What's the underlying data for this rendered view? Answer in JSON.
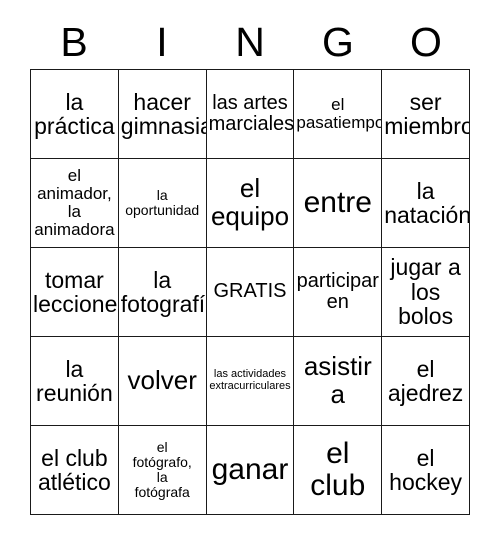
{
  "card": {
    "title": "BINGO",
    "header_letters": [
      "B",
      "I",
      "N",
      "G",
      "O"
    ],
    "columns": 5,
    "rows": 5,
    "border_color": "#1a1a1a",
    "background_color": "#ffffff",
    "text_color": "#000000"
  },
  "cells": [
    {
      "text": "la\npráctica",
      "size": "lg",
      "row": 1,
      "col": 1
    },
    {
      "text": "hacer\ngimnasia",
      "size": "lg",
      "row": 1,
      "col": 2
    },
    {
      "text": "las artes\nmarciales",
      "size": "md",
      "row": 1,
      "col": 3
    },
    {
      "text": "el\npasatiempo",
      "size": "sm",
      "row": 1,
      "col": 4
    },
    {
      "text": "ser\nmiembro",
      "size": "lg",
      "row": 1,
      "col": 5
    },
    {
      "text": "el\nanimador,\nla\nanimadora",
      "size": "sm",
      "row": 2,
      "col": 1
    },
    {
      "text": "la\noportunidad",
      "size": "xs",
      "row": 2,
      "col": 2
    },
    {
      "text": "el\nequipo",
      "size": "xl",
      "row": 2,
      "col": 3
    },
    {
      "text": "entre",
      "size": "xxl",
      "row": 2,
      "col": 4
    },
    {
      "text": "la\nnatación",
      "size": "lg",
      "row": 2,
      "col": 5
    },
    {
      "text": "tomar\nlecciones",
      "size": "lg",
      "row": 3,
      "col": 1
    },
    {
      "text": "la\nfotografía",
      "size": "lg",
      "row": 3,
      "col": 2
    },
    {
      "text": "GRATIS",
      "size": "md",
      "row": 3,
      "col": 3
    },
    {
      "text": "participar\nen",
      "size": "md",
      "row": 3,
      "col": 4
    },
    {
      "text": "jugar a\nlos\nbolos",
      "size": "lg",
      "row": 3,
      "col": 5
    },
    {
      "text": "la\nreunión",
      "size": "lg",
      "row": 4,
      "col": 1
    },
    {
      "text": "volver",
      "size": "xl",
      "row": 4,
      "col": 2
    },
    {
      "text": "las actividades\nextracurriculares",
      "size": "xxs",
      "row": 4,
      "col": 3
    },
    {
      "text": "asistir\na",
      "size": "xl",
      "row": 4,
      "col": 4
    },
    {
      "text": "el\najedrez",
      "size": "lg",
      "row": 4,
      "col": 5
    },
    {
      "text": "el club\natlético",
      "size": "lg",
      "row": 5,
      "col": 1
    },
    {
      "text": "el\nfotógrafo,\nla\nfotógrafa",
      "size": "xs",
      "row": 5,
      "col": 2
    },
    {
      "text": "ganar",
      "size": "xxl",
      "row": 5,
      "col": 3
    },
    {
      "text": "el\nclub",
      "size": "xxl",
      "row": 5,
      "col": 4
    },
    {
      "text": "el\nhockey",
      "size": "lg",
      "row": 5,
      "col": 5
    }
  ]
}
